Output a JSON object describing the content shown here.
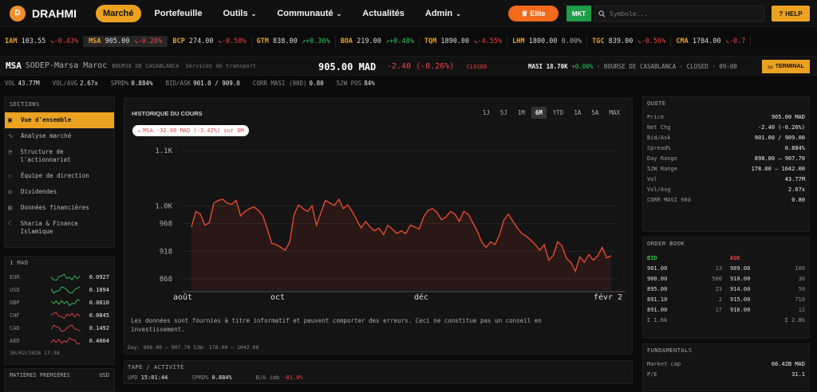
{
  "brand": {
    "initial": "D",
    "name": "DRAHMI"
  },
  "nav": [
    {
      "label": "Marché",
      "active": true,
      "caret": false
    },
    {
      "label": "Portefeuille",
      "active": false,
      "caret": false
    },
    {
      "label": "Outils",
      "active": false,
      "caret": true
    },
    {
      "label": "Communauté",
      "active": false,
      "caret": true
    },
    {
      "label": "Actualités",
      "active": false,
      "caret": false
    },
    {
      "label": "Admin",
      "active": false,
      "caret": true
    }
  ],
  "elite": "Elite",
  "mkt": "MKT",
  "search_placeholder": "Symbole...",
  "help": "HELP",
  "ticker": [
    {
      "sym": "IAM",
      "price": "103.55",
      "chg": "-0.43%",
      "dir": "dn"
    },
    {
      "sym": "MSA",
      "price": "905.00",
      "chg": "-0.26%",
      "dir": "dn",
      "sel": true
    },
    {
      "sym": "BCP",
      "price": "274.00",
      "chg": "-0.58%",
      "dir": "dn"
    },
    {
      "sym": "GTM",
      "price": "838.00",
      "chg": "+0.36%",
      "dir": "up"
    },
    {
      "sym": "BOA",
      "price": "219.00",
      "chg": "+0.48%",
      "dir": "up"
    },
    {
      "sym": "TQM",
      "price": "1890.00",
      "chg": "-4.55%",
      "dir": "dn"
    },
    {
      "sym": "LHM",
      "price": "1800.00",
      "chg": "0.00%",
      "dir": "zero"
    },
    {
      "sym": "TGC",
      "price": "839.00",
      "chg": "-0.56%",
      "dir": "dn"
    },
    {
      "sym": "CMA",
      "price": "1784.00",
      "chg": "-0.7",
      "dir": "dn"
    }
  ],
  "security": {
    "symbol": "MSA",
    "name": "SODEP-Marsa Maroc",
    "exchange": "BOURSE DE CASABLANCA",
    "sector": "Services de transport",
    "price": "905.00 MAD",
    "change": "-2.40 (-0.26%)",
    "status": "CLOSED",
    "masi_label": "MASI",
    "masi_value": "18.70K",
    "masi_chg": "+0.00%",
    "masi_info": "· BOURSE DE CASABLANCA · CLOSED · 09:00",
    "terminal": "TERMINAL"
  },
  "stats": [
    {
      "l": "VOL",
      "v": "43.77M"
    },
    {
      "l": "VOL/AVG",
      "v": "2.67x"
    },
    {
      "l": "SPRD%",
      "v": "0.884%"
    },
    {
      "l": "BID/ASK",
      "v": "901.0 / 909.0"
    },
    {
      "l": "CORR MASI (90D)",
      "v": "0.80"
    },
    {
      "l": "52W POS",
      "v": "84%"
    }
  ],
  "sections": {
    "title": "SECTIONS",
    "items": [
      {
        "label": "Vue d'ensemble",
        "icon": "overview-icon",
        "glyph": "▣",
        "active": true
      },
      {
        "label": "Analyse marché",
        "icon": "chart-icon",
        "glyph": "∿",
        "active": false
      },
      {
        "label": "Structure de l'actionnariat",
        "icon": "pie-icon",
        "glyph": "◔",
        "active": false
      },
      {
        "label": "Équipe de direction",
        "icon": "people-icon",
        "glyph": "⚇",
        "active": false
      },
      {
        "label": "Dividendes",
        "icon": "coin-icon",
        "glyph": "◎",
        "active": false
      },
      {
        "label": "Données financières",
        "icon": "document-icon",
        "glyph": "▤",
        "active": false
      },
      {
        "label": "Sharia & Finance Islamique",
        "icon": "moon-icon",
        "glyph": "☾",
        "active": false
      }
    ]
  },
  "fx": {
    "title": "1 MAD",
    "rows": [
      {
        "c": "EUR",
        "v": "0.0927",
        "col": "#34c759"
      },
      {
        "c": "USD",
        "v": "0.1094",
        "col": "#34c759"
      },
      {
        "c": "GBP",
        "v": "0.0810",
        "col": "#34c759"
      },
      {
        "c": "CHF",
        "v": "0.0845",
        "col": "#ef4444"
      },
      {
        "c": "CAD",
        "v": "0.1492",
        "col": "#ef4444"
      },
      {
        "c": "AED",
        "v": "0.4004",
        "col": "#ef4444"
      }
    ],
    "time": "20/02/2026 17:38"
  },
  "matieres": {
    "title": "MATIÈRES PREMIÈRES",
    "unit": "USD"
  },
  "chart": {
    "title": "HISTORIQUE DU COURS",
    "ranges": [
      "1J",
      "5J",
      "1M",
      "6M",
      "YTD",
      "1A",
      "5A",
      "MAX"
    ],
    "selected": "6M",
    "pill": "MSA -32.00 MAD (-3.42%) sur 6M",
    "disclaimer": "Les données sont fournies à titre informatif et peuvent comporter des erreurs. Ceci ne constitue pas un conseil en investissement.",
    "footer": "Day: 898.00 – 907.70   52W: 178.00 – 1042.00"
  },
  "chart_data": {
    "type": "line",
    "x_tick_labels": [
      "août",
      "oct",
      "déc",
      "févr 2"
    ],
    "y_tick_labels": [
      "1.1K",
      "1.0K",
      "968",
      "918",
      "868"
    ],
    "y_ticks": [
      1100,
      1000,
      968,
      918,
      868
    ],
    "ylim": [
      848,
      1110
    ],
    "series": [
      {
        "values": [
          962,
          990,
          985,
          965,
          970,
          1005,
          1010,
          1012,
          1005,
          1003,
          1010,
          982,
          990,
          995,
          998,
          992,
          982,
          958,
          932,
          930,
          925,
          920,
          935,
          985,
          1002,
          995,
          990,
          1000,
          965,
          988,
          1010,
          1005,
          1001,
          1012,
          995,
          1002,
          990,
          975,
          960,
          972,
          962,
          955,
          960,
          948,
          965,
          958,
          950,
          955,
          950,
          965,
          962,
          958,
          980,
          992,
          995,
          988,
          975,
          980,
          990,
          985,
          972,
          990,
          985,
          970,
          955,
          935,
          925,
          935,
          930,
          948,
          975,
          985,
          972,
          960,
          950,
          945,
          938,
          930,
          920,
          930,
          902,
          910,
          935,
          928,
          905,
          898,
          882,
          908,
          898,
          912,
          902,
          910,
          925,
          906,
          910
        ]
      }
    ],
    "color": "#e8492f"
  },
  "tape": {
    "title": "TAPE / ACTIVITÉ",
    "upd": "UPD",
    "time": "15:01:44",
    "sprd_l": "SPRD%",
    "sprd_v": "0.884%",
    "imb_l": "B/A imb",
    "imb_v": "-01.0%"
  },
  "quote": {
    "title": "QUOTE",
    "rows": [
      {
        "l": "Price",
        "v": "905.00 MAD"
      },
      {
        "l": "Net Chg",
        "v": "-2.40 (-0.26%)",
        "dn": true
      },
      {
        "l": "Bid/Ask",
        "v": "901.00 / 909.00"
      },
      {
        "l": "Spread%",
        "v": "0.884%"
      },
      {
        "l": "Day Range",
        "v": "898.00 – 907.70"
      },
      {
        "l": "52W Range",
        "v": "178.00 – 1042.00"
      },
      {
        "l": "Vol",
        "v": "43.77M"
      },
      {
        "l": "Vol/Avg",
        "v": "2.67x"
      },
      {
        "l": "CORR MASI 90d",
        "v": "0.80"
      }
    ]
  },
  "orderbook": {
    "title": "ORDER BOOK",
    "bid_label": "BID",
    "ask_label": "ASK",
    "rows": [
      {
        "b": "901.00",
        "bq": "13",
        "a": "909.00",
        "aq": "100"
      },
      {
        "b": "900.00",
        "bq": "500",
        "a": "910.00",
        "aq": "30"
      },
      {
        "b": "895.00",
        "bq": "23",
        "a": "914.00",
        "aq": "50"
      },
      {
        "b": "891.10",
        "bq": "2",
        "a": "915.00",
        "aq": "710"
      },
      {
        "b": "891.00",
        "bq": "17",
        "a": "916.00",
        "aq": "12"
      }
    ],
    "bid_total": "Σ 1.6k",
    "ask_total": "Σ 2.8k"
  },
  "fundamentals": {
    "title": "FUNDAMENTALS",
    "rows": [
      {
        "l": "Market cap",
        "v": "66.42B MAD"
      },
      {
        "l": "P/E",
        "v": "31.1"
      }
    ]
  }
}
